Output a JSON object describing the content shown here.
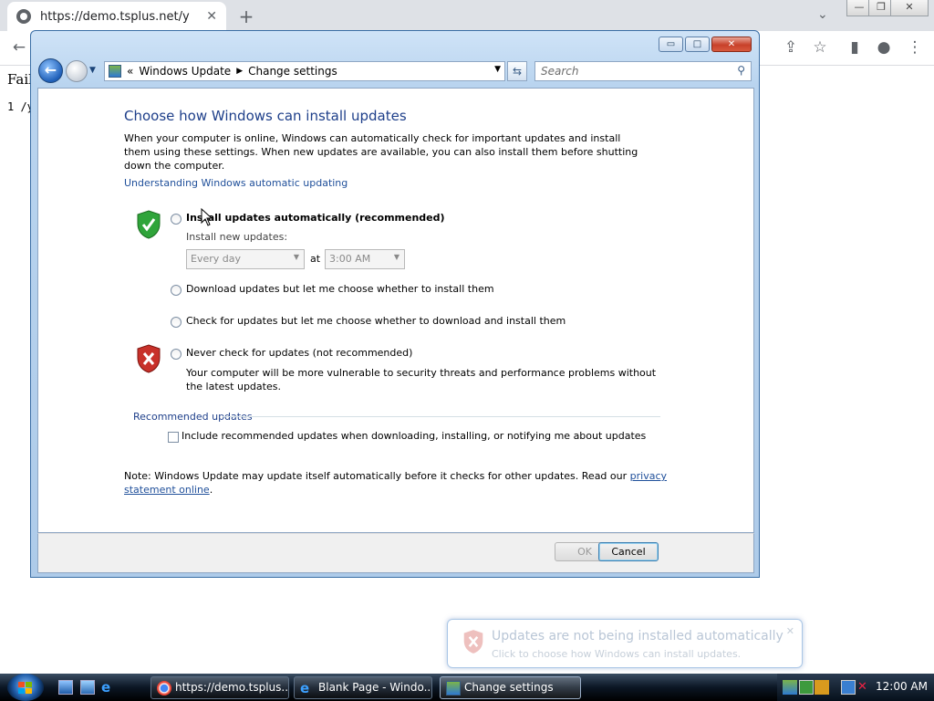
{
  "browser": {
    "tab_title": "https://demo.tsplus.net/y",
    "tab_close": "✕",
    "new_tab": "+",
    "dropdown": "⌄",
    "win_min": "—",
    "win_restore": "❐",
    "win_close": "✕",
    "back": "←",
    "page_text_1": "Fail",
    "page_text_2": "1 /y"
  },
  "window": {
    "min": "▭",
    "max": "□",
    "close": "✕",
    "address": {
      "chevrons": "«",
      "crumb1": "Windows Update",
      "crumb2": "Change settings"
    },
    "search_placeholder": "Search",
    "heading": "Choose how Windows can install updates",
    "intro": "When your computer is online, Windows can automatically check for important updates and install them using these settings. When new updates are available, you can also install them before shutting down the computer.",
    "understanding_link": "Understanding Windows automatic updating",
    "options": [
      {
        "label": "Install updates automatically (recommended)"
      },
      {
        "label": "Download updates but let me choose whether to install them"
      },
      {
        "label": "Check for updates but let me choose whether to download and install them"
      },
      {
        "label": "Never check for updates (not recommended)"
      }
    ],
    "install_new_updates": "Install new updates:",
    "day_select": "Every day",
    "at_label": "at",
    "time_select": "3:00 AM",
    "warning": "Your computer will be more vulnerable to security threats and performance problems without the latest updates.",
    "recommended_group": "Recommended updates",
    "recommended_checkbox": "Include recommended updates when downloading, installing, or notifying me about updates",
    "note_text": "Note: Windows Update may update itself automatically before it checks for other updates.  Read our ",
    "note_link": "privacy statement online",
    "note_end": ".",
    "ok": "OK",
    "cancel": "Cancel"
  },
  "balloon": {
    "title": "Updates are not being installed automatically",
    "body": "Click to choose how Windows can install updates.",
    "close": "✕"
  },
  "taskbar": {
    "items": [
      {
        "label": "https://demo.tsplus..."
      },
      {
        "label": "Blank Page - Windo..."
      },
      {
        "label": "Change settings"
      }
    ],
    "clock": "12:00 AM"
  },
  "colors": {
    "link": "#1f4f9a",
    "heading": "#1e3f8a",
    "taskbar": "#0b1624"
  }
}
